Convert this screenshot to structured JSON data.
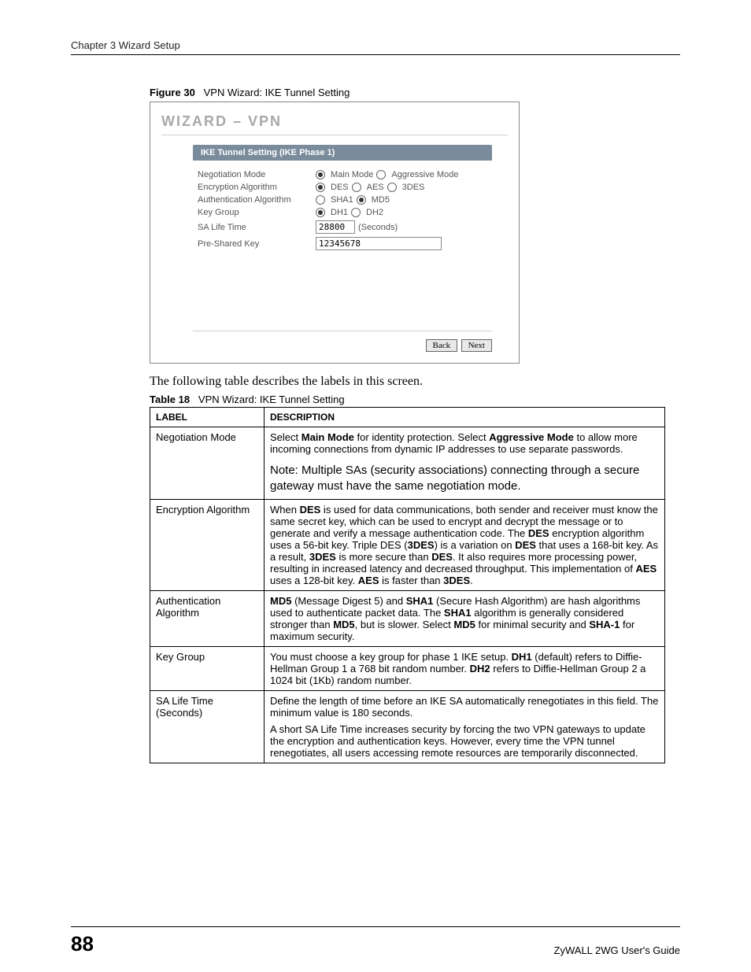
{
  "header": {
    "chapter": "Chapter 3 Wizard Setup"
  },
  "figure": {
    "label": "Figure 30",
    "title": "VPN Wizard: IKE Tunnel Setting"
  },
  "wizard": {
    "title": "WIZARD – VPN",
    "section": "IKE Tunnel Setting (IKE Phase 1)",
    "rows": {
      "negotiation": {
        "label": "Negotiation Mode",
        "opt1": "Main Mode",
        "opt2": "Aggressive Mode",
        "selected": "opt1"
      },
      "encryption": {
        "label": "Encryption Algorithm",
        "opt1": "DES",
        "opt2": "AES",
        "opt3": "3DES",
        "selected": "opt1"
      },
      "auth": {
        "label": "Authentication Algorithm",
        "opt1": "SHA1",
        "opt2": "MD5",
        "selected": "opt2"
      },
      "keygroup": {
        "label": "Key Group",
        "opt1": "DH1",
        "opt2": "DH2",
        "selected": "opt1"
      },
      "salife": {
        "label": "SA Life Time",
        "value": "28800",
        "unit": "(Seconds)"
      },
      "psk": {
        "label": "Pre-Shared Key",
        "value": "12345678"
      }
    },
    "buttons": {
      "back": "Back",
      "next": "Next"
    }
  },
  "intro_text": "The following table describes the labels in this screen.",
  "table": {
    "label": "Table 18",
    "title": "VPN Wizard: IKE Tunnel Setting",
    "head": {
      "c1": "LABEL",
      "c2": "DESCRIPTION"
    },
    "rows": [
      {
        "label": "Negotiation Mode",
        "desc_pre": "Select ",
        "b1": "Main Mode",
        "desc_mid1": " for identity protection. Select ",
        "b2": "Aggressive Mode",
        "desc_post": " to allow more incoming connections from dynamic IP addresses to use separate passwords.",
        "note": "Note: Multiple SAs (security associations) connecting through a secure gateway must have the same negotiation mode."
      },
      {
        "label": "Encryption Algorithm",
        "t1": "When ",
        "b1": "DES",
        "t2": " is used for data communications, both sender and receiver must know the same secret key, which can be used to encrypt and decrypt the message or to generate and verify a message authentication code. The ",
        "b2": "DES",
        "t3": " encryption algorithm uses a 56-bit key. Triple DES (",
        "b3": "3DES",
        "t4": ") is a variation on ",
        "b4": "DES",
        "t5": " that uses a 168-bit key. As a result, ",
        "b5": "3DES",
        "t6": " is more secure than ",
        "b6": "DES",
        "t7": ". It also requires more processing power, resulting in increased latency and decreased throughput.  This implementation of ",
        "b7": "AES",
        "t8": " uses a 128-bit key. ",
        "b8": "AES",
        "t9": " is faster than ",
        "b9": "3DES",
        "t10": "."
      },
      {
        "label": "Authentication Algorithm",
        "b1": "MD5",
        "t1": " (Message Digest 5) and ",
        "b2": "SHA1",
        "t2": " (Secure Hash Algorithm) are hash algorithms used to authenticate packet data. The ",
        "b3": "SHA1",
        "t3": " algorithm is generally considered stronger than ",
        "b4": "MD5",
        "t4": ", but is slower. Select ",
        "b5": "MD5",
        "t5": " for minimal security and ",
        "b6": "SHA-1",
        "t6": " for maximum security."
      },
      {
        "label": "Key Group",
        "t1": "You must choose a key group for phase 1 IKE setup. ",
        "b1": "DH1",
        "t2": " (default) refers to Diffie-Hellman Group 1 a 768 bit random number. ",
        "b2": "DH2",
        "t3": " refers to Diffie-Hellman Group 2 a 1024 bit (1Kb) random number."
      },
      {
        "label": "SA Life Time (Seconds)",
        "p1": "Define the length of time before an IKE SA automatically renegotiates in this field. The minimum value is 180 seconds.",
        "p2": "A short SA Life Time increases security by forcing the two VPN gateways to update the encryption and authentication keys. However, every time the VPN tunnel renegotiates, all users accessing remote resources are temporarily disconnected."
      }
    ]
  },
  "footer": {
    "page": "88",
    "guide": "ZyWALL 2WG User's Guide"
  }
}
